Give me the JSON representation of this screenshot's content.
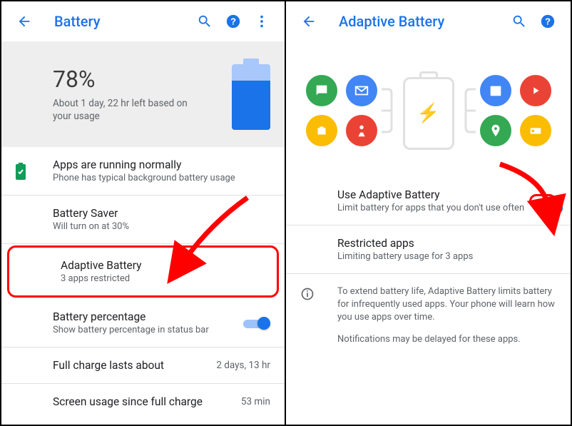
{
  "left": {
    "appbar": {
      "title": "Battery"
    },
    "hero": {
      "percent": "78%",
      "estimate": "About 1 day, 22 hr left based on your usage"
    },
    "apps_row": {
      "title": "Apps are running normally",
      "sub": "Phone has typical background battery usage"
    },
    "battery_saver": {
      "title": "Battery Saver",
      "sub": "Will turn on at 30%"
    },
    "adaptive": {
      "title": "Adaptive Battery",
      "sub": "3 apps restricted"
    },
    "percentage": {
      "title": "Battery percentage",
      "sub": "Show battery percentage in status bar"
    },
    "full_charge": {
      "title": "Full charge lasts about",
      "value": "2 days, 13 hr"
    },
    "screen_usage": {
      "title": "Screen usage since full charge",
      "value": "53 min"
    }
  },
  "right": {
    "appbar": {
      "title": "Adaptive Battery"
    },
    "use_adaptive": {
      "title": "Use Adaptive Battery",
      "sub": "Limit battery for apps that you don't use often"
    },
    "restricted": {
      "title": "Restricted apps",
      "sub": "Limiting battery usage for 3 apps"
    },
    "info1": "To extend battery life, Adaptive Battery limits battery for infrequently used apps. Your phone will learn how you use apps over time.",
    "info2": "Notifications may be delayed for these apps."
  }
}
